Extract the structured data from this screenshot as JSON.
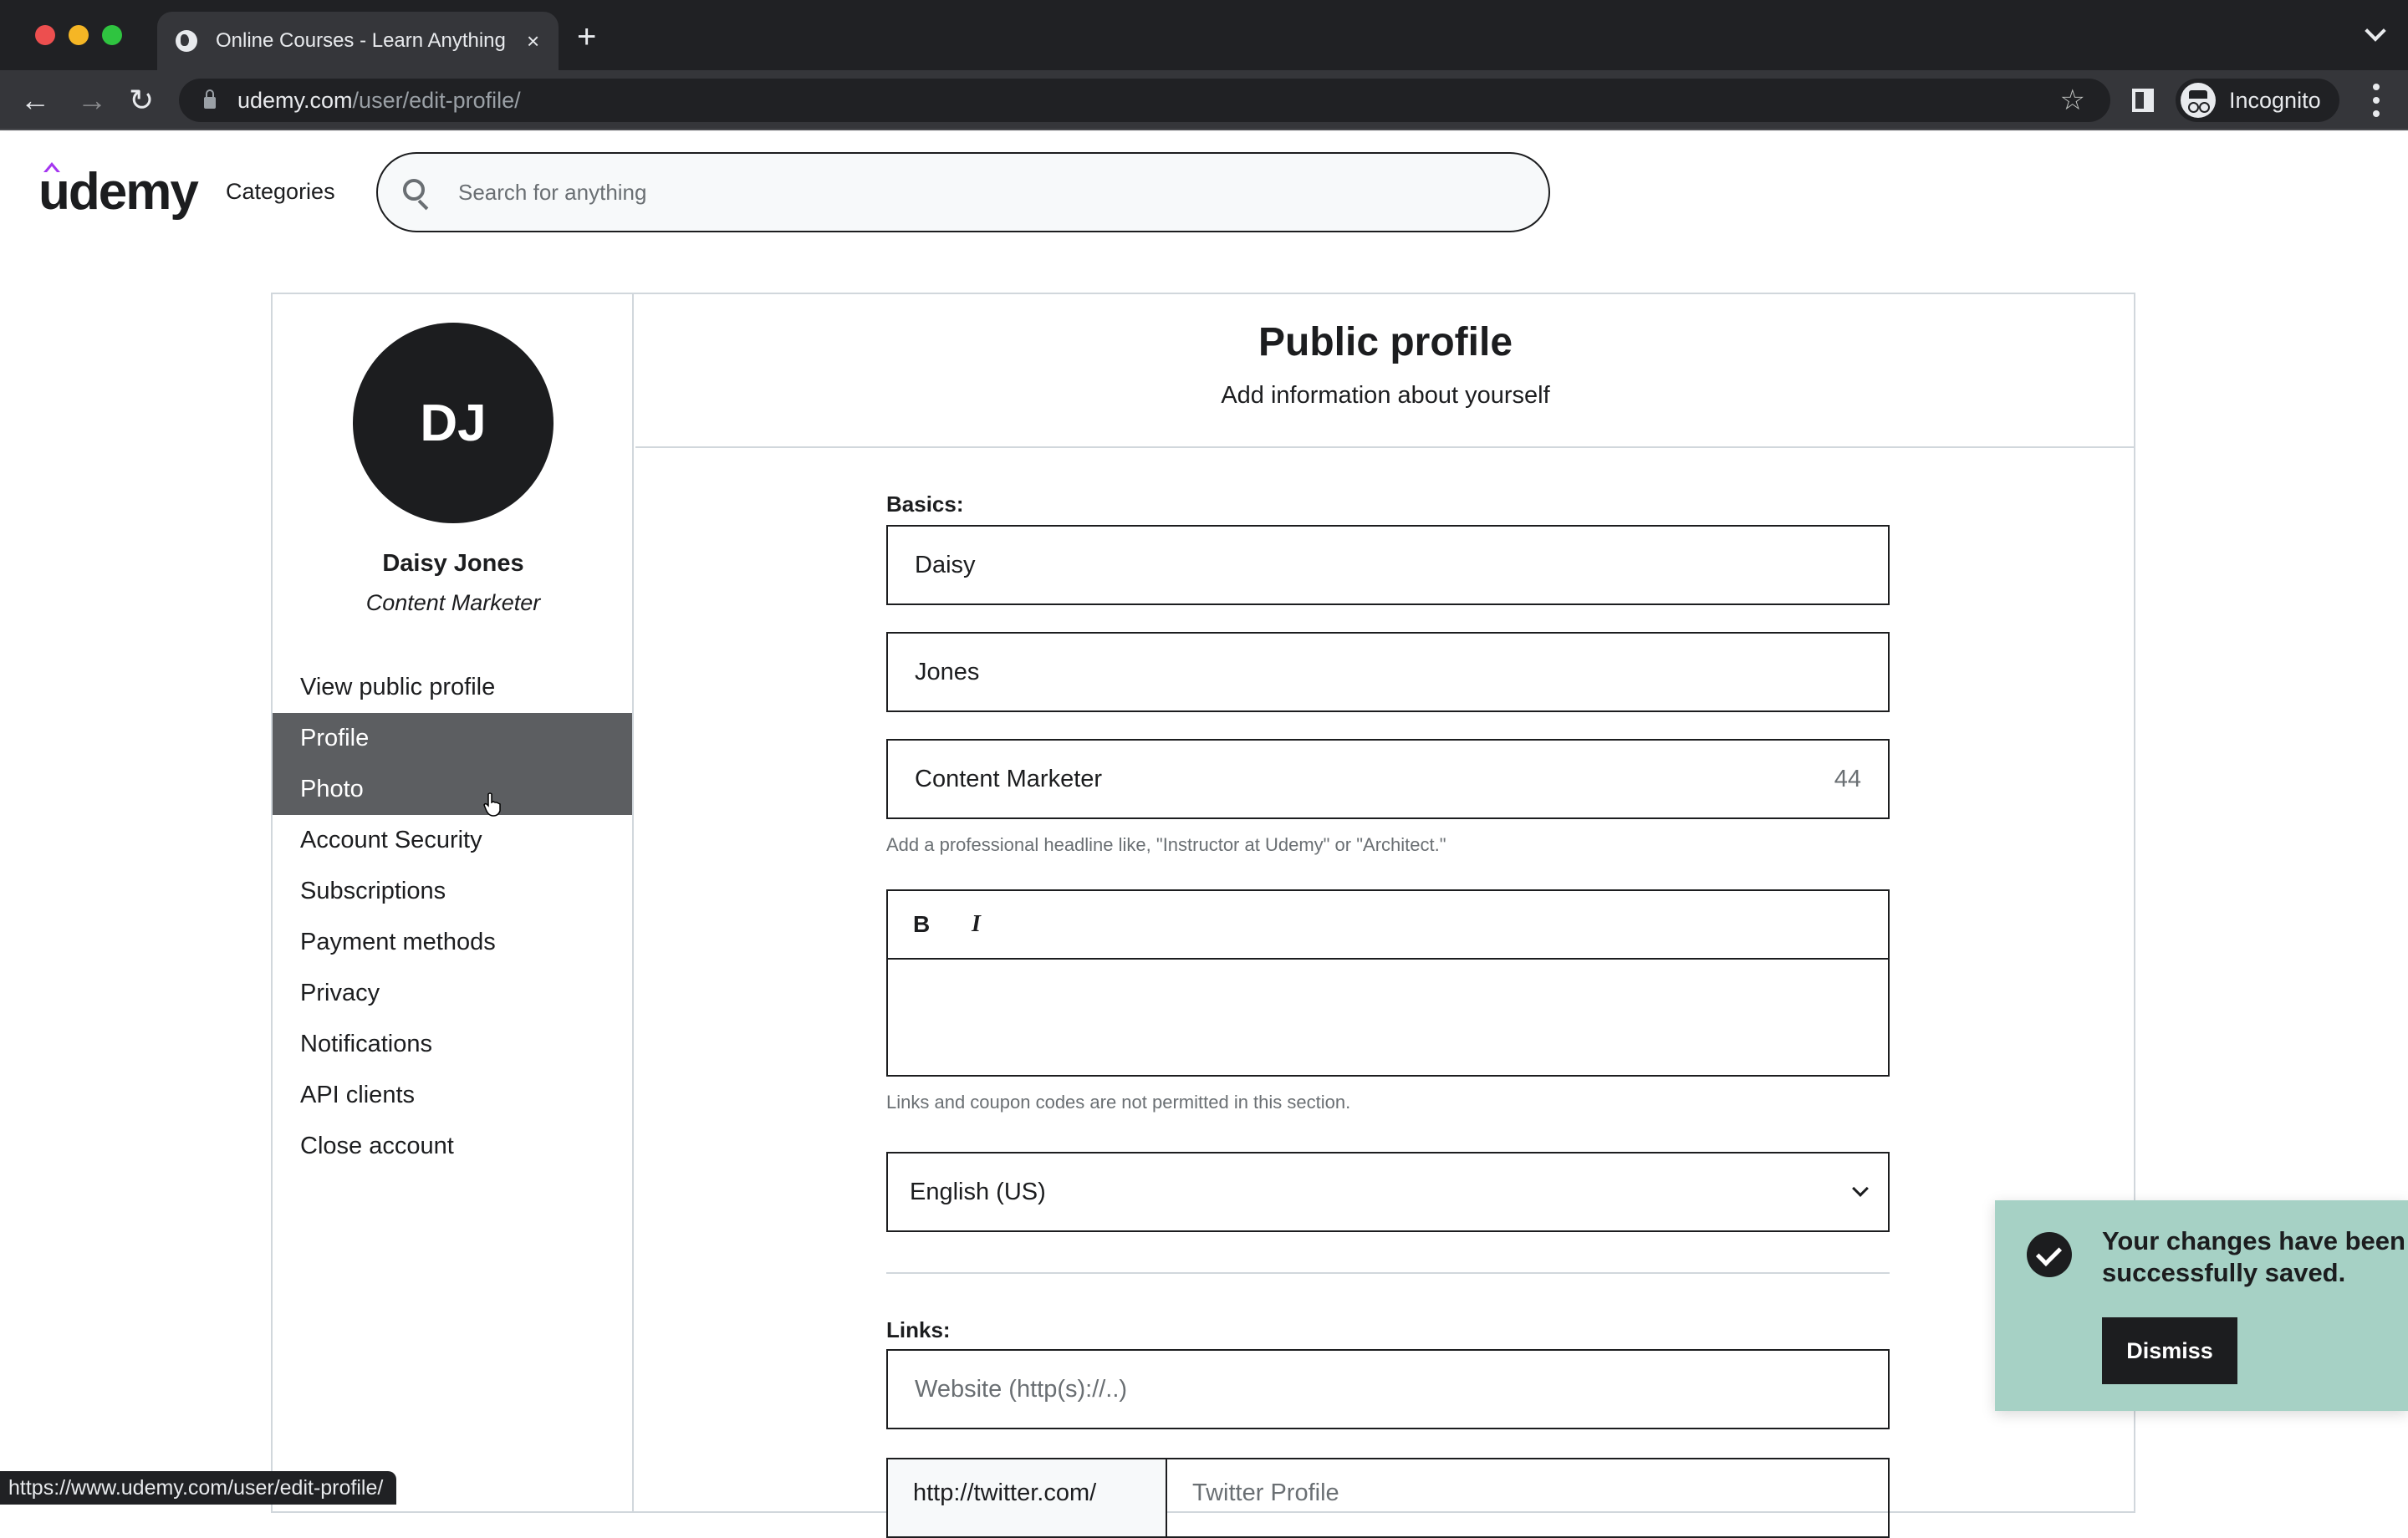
{
  "browser": {
    "tab_title": "Online Courses - Learn Anything",
    "tab_close": "×",
    "new_tab": "+",
    "url_domain": "udemy.com",
    "url_path": "/user/edit-profile/",
    "incognito_label": "Incognito",
    "status_url": "https://www.udemy.com/user/edit-profile/"
  },
  "header": {
    "logo": "udemy",
    "categories": "Categories",
    "search_placeholder": "Search for anything"
  },
  "sidebar": {
    "avatar_initials": "DJ",
    "name": "Daisy Jones",
    "headline": "Content Marketer",
    "items": [
      {
        "label": "View public profile",
        "active": false
      },
      {
        "label": "Profile",
        "active": true
      },
      {
        "label": "Photo",
        "active": true
      },
      {
        "label": "Account Security",
        "active": false
      },
      {
        "label": "Subscriptions",
        "active": false
      },
      {
        "label": "Payment methods",
        "active": false
      },
      {
        "label": "Privacy",
        "active": false
      },
      {
        "label": "Notifications",
        "active": false
      },
      {
        "label": "API clients",
        "active": false
      },
      {
        "label": "Close account",
        "active": false
      }
    ]
  },
  "main": {
    "title": "Public profile",
    "subtitle": "Add information about yourself",
    "basics_label": "Basics:",
    "first_name": "Daisy",
    "last_name": "Jones",
    "headline_value": "Content Marketer",
    "headline_counter": "44",
    "headline_hint": "Add a professional headline like, \"Instructor at Udemy\" or \"Architect.\"",
    "editor_bold": "B",
    "editor_italic": "I",
    "bio_hint": "Links and coupon codes are not permitted in this section.",
    "language": "English (US)",
    "links_label": "Links:",
    "website_placeholder": "Website (http(s)://..)",
    "twitter_prefix": "http://twitter.com/",
    "twitter_placeholder": "Twitter Profile"
  },
  "toast": {
    "message": "Your changes have been successfully saved.",
    "dismiss": "Dismiss",
    "background": "#a6d1c5"
  }
}
